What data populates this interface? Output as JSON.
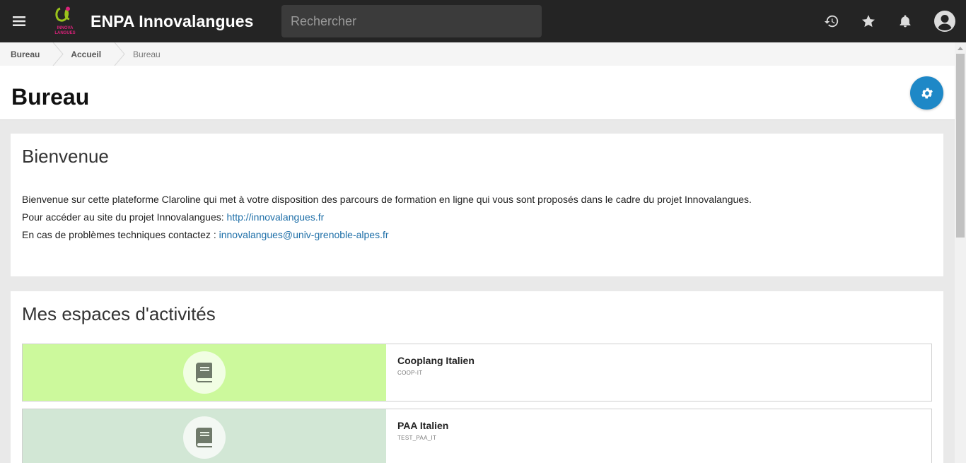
{
  "header": {
    "title": "ENPA Innovalangues",
    "logo_text": "INNOVA LANGUES",
    "search_placeholder": "Rechercher",
    "icons": [
      "menu-icon",
      "history-icon",
      "star-icon",
      "bell-icon",
      "user-avatar-icon"
    ]
  },
  "breadcrumb": {
    "items": [
      "Bureau",
      "Accueil"
    ],
    "current": "Bureau"
  },
  "page": {
    "title": "Bureau",
    "settings_icon": "gear-icon"
  },
  "welcome": {
    "title": "Bienvenue",
    "line1": "Bienvenue sur cette plateforme Claroline qui met à votre disposition des parcours de formation en ligne qui vous sont proposés dans le cadre du projet Innovalangues.",
    "line2_prefix": "Pour accéder au site du projet Innovalangues: ",
    "line2_link": "http://innovalangues.fr",
    "line3_prefix": "En cas de problèmes techniques contactez : ",
    "line3_link": "innovalangues@univ-grenoble-alpes.fr"
  },
  "workspaces": {
    "title": "Mes espaces d'activités",
    "items": [
      {
        "name": "Cooplang Italien",
        "code": "COOP-IT",
        "color": "#ccf99c",
        "icon": "book-icon"
      },
      {
        "name": "PAA Italien",
        "code": "TEST_PAA_IT",
        "color": "#d2e7d5",
        "icon": "book-icon"
      }
    ]
  },
  "colors": {
    "topbar": "#242424",
    "accent": "#1e88c7",
    "link": "#1e6fa8",
    "logo_green": "#9bc31c",
    "logo_pink": "#d9227a"
  }
}
